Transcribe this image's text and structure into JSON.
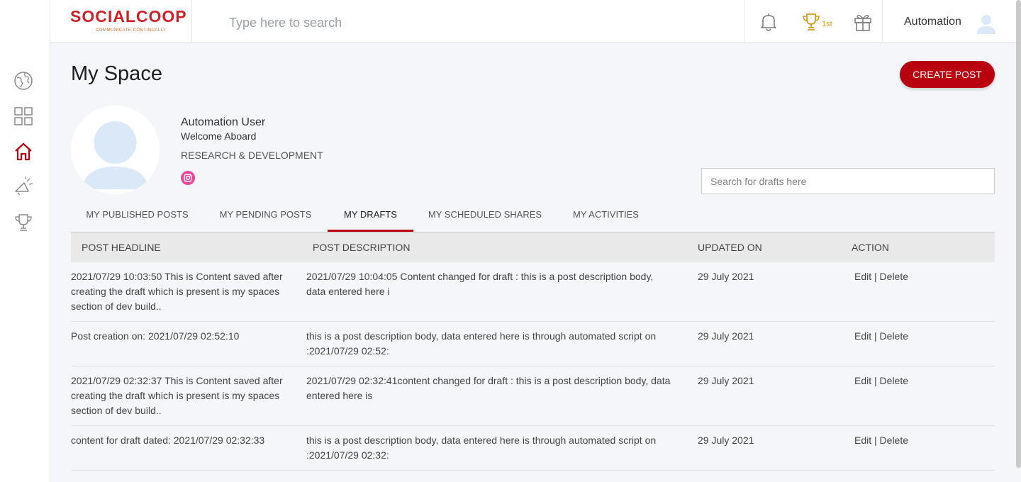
{
  "brand": {
    "name": "SOCIALCOOP",
    "tagline": "COMMUNICATE CONTINUALLY"
  },
  "header": {
    "search_placeholder": "Type here to search",
    "rank": "1st",
    "user_name": "Automation"
  },
  "sidebar": {
    "icons": [
      "globe-icon",
      "grid-icon",
      "home-icon",
      "megaphone-icon",
      "trophy-icon"
    ],
    "active": "home-icon"
  },
  "page": {
    "title": "My Space",
    "create_button": "CREATE POST"
  },
  "profile": {
    "name": "Automation User",
    "welcome": "Welcome Aboard",
    "department": "RESEARCH & DEVELOPMENT"
  },
  "drafts_search": {
    "placeholder": "Search for drafts here"
  },
  "tabs": [
    {
      "label": "MY PUBLISHED POSTS",
      "active": false
    },
    {
      "label": "MY PENDING POSTS",
      "active": false
    },
    {
      "label": "MY DRAFTS",
      "active": true
    },
    {
      "label": "MY SCHEDULED SHARES",
      "active": false
    },
    {
      "label": "MY ACTIVITIES",
      "active": false
    }
  ],
  "table": {
    "columns": [
      "POST HEADLINE",
      "POST DESCRIPTION",
      "UPDATED ON",
      "ACTION"
    ],
    "edit_label": "Edit",
    "separator": "|",
    "delete_label": "Delete",
    "rows": [
      {
        "headline": "2021/07/29 10:03:50 This is Content saved after creating the draft which is present is my spaces section of dev build..",
        "description": "2021/07/29 10:04:05 Content changed for draft : this is a post description body, data entered here i",
        "updated": "29 July 2021"
      },
      {
        "headline": "Post creation on: 2021/07/29 02:52:10",
        "description": "this is a post description body, data entered here is through automated script on :2021/07/29 02:52:",
        "updated": "29 July 2021"
      },
      {
        "headline": "2021/07/29 02:32:37 This is Content saved after creating the draft which is present is my spaces section of dev build..",
        "description": "2021/07/29 02:32:41content changed for draft : this is a post description body, data entered here is",
        "updated": "29 July 2021"
      },
      {
        "headline": "content for draft dated: 2021/07/29 02:32:33",
        "description": "this is a post description body, data entered here is through automated script on :2021/07/29 02:32:",
        "updated": "29 July 2021"
      }
    ]
  },
  "colors": {
    "accent": "#b8000e",
    "brand_red": "#d0202a",
    "brand_orange": "#e2672a",
    "gold": "#d59a1a"
  }
}
